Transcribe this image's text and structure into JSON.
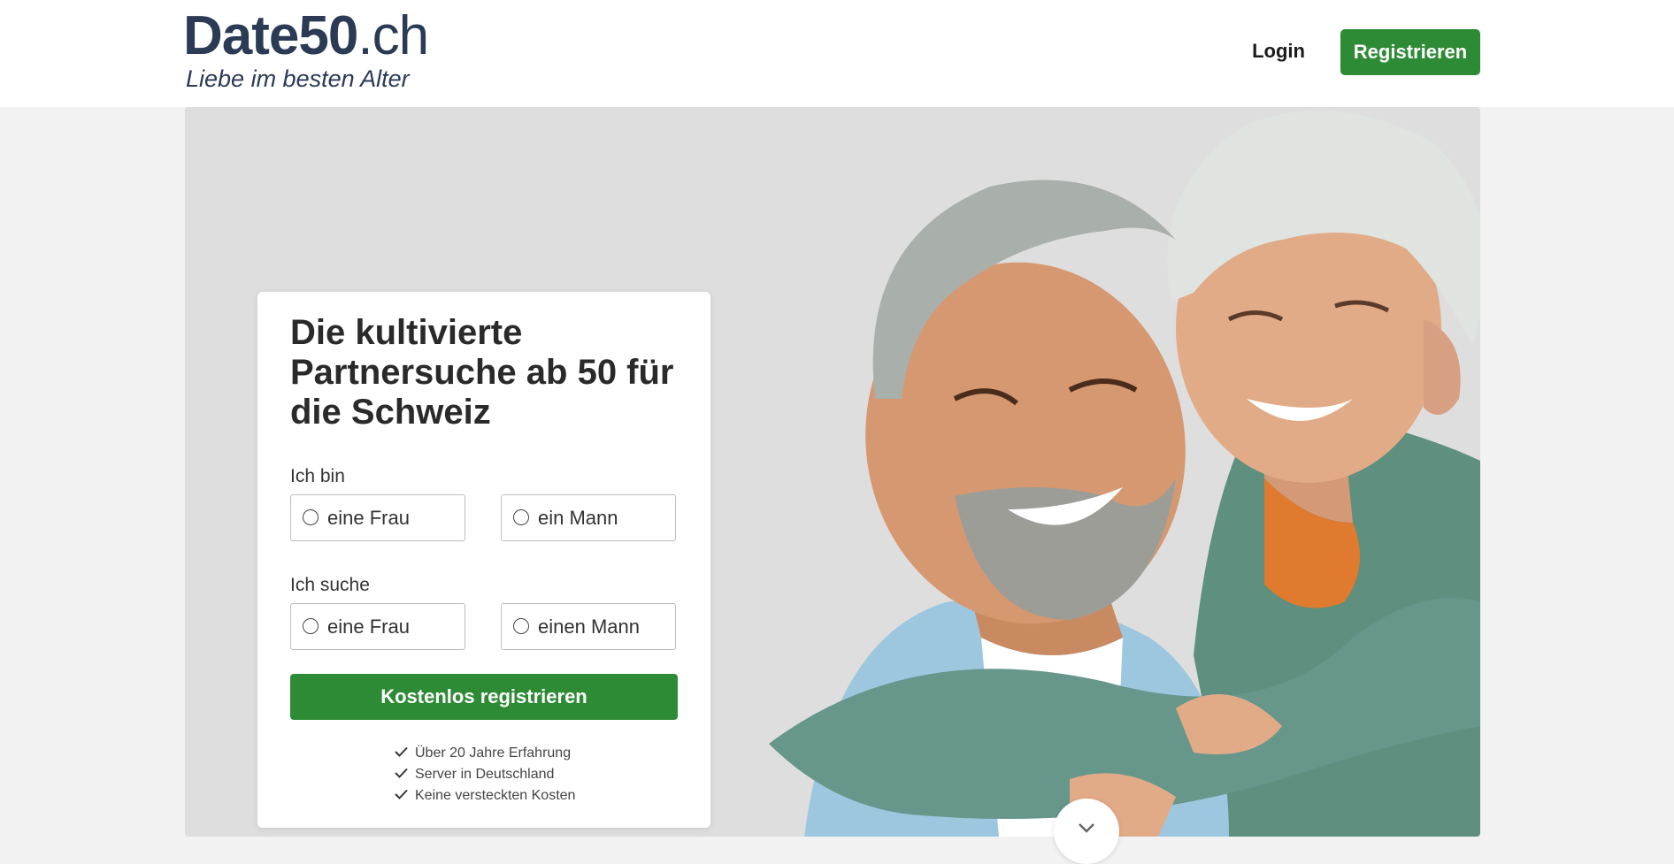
{
  "header": {
    "logo_brand": "Date50",
    "logo_tld": ".ch",
    "tagline": "Liebe im besten Alter",
    "login_label": "Login",
    "register_label": "Registrieren"
  },
  "form": {
    "title": "Die kultivierte Partnersuche ab 50 für die Schweiz",
    "i_am_label": "Ich bin",
    "i_am_options": [
      "eine Frau",
      "ein Mann"
    ],
    "seeking_label": "Ich suche",
    "seeking_options": [
      "eine Frau",
      "einen Mann"
    ],
    "cta_label": "Kostenlos registrieren",
    "benefits": [
      "Über 20 Jahre Erfahrung",
      "Server in Deutschland",
      "Keine versteckten Kosten"
    ]
  },
  "icons": {
    "check": "check-icon",
    "scroll": "chevron-down-icon"
  },
  "colors": {
    "brand_navy": "#2b3a55",
    "accent_green": "#2e8b35",
    "hero_bg": "#dedede",
    "page_bg": "#f2f2f2"
  }
}
